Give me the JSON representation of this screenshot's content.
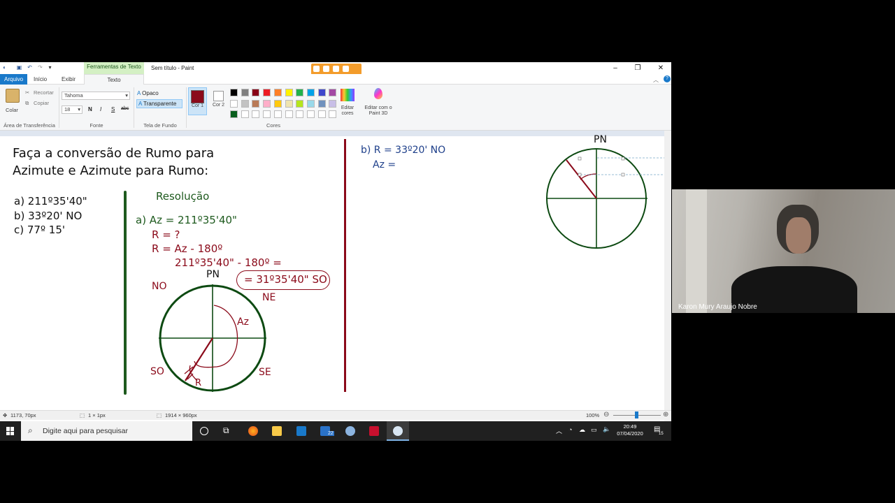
{
  "window": {
    "title": "Sem título - Paint",
    "context_tab": "Ferramentas de Texto"
  },
  "tabs": [
    "Arquivo",
    "Início",
    "Exibir",
    "Texto"
  ],
  "ribbon": {
    "clipboard": {
      "paste": "Colar",
      "cut": "Recortar",
      "copy": "Copiar",
      "group": "Área de Transferência"
    },
    "font": {
      "family": "Tahoma",
      "size": "18",
      "bold": "N",
      "italic": "I",
      "underline": "S",
      "strike": "abc",
      "group": "Fonte"
    },
    "background": {
      "opaque": "Opaco",
      "transparent": "Transparente",
      "group": "Tela de Fundo"
    },
    "colors": {
      "color1": "Cor 1",
      "color1_value": "#8b0a1a",
      "color2": "Cor 2",
      "color2_value": "#ffffff",
      "edit": "Editar cores",
      "paint3d": "Editar com o Paint 3D",
      "group": "Cores",
      "palette_row1": [
        "#000000",
        "#7f7f7f",
        "#880015",
        "#ed1c24",
        "#ff7f27",
        "#fff200",
        "#22b14c",
        "#00a2e8",
        "#3f48cc",
        "#a349a4"
      ],
      "palette_row2": [
        "#ffffff",
        "#c3c3c3",
        "#b97a57",
        "#ffaec9",
        "#ffc90e",
        "#efe4b0",
        "#b5e61d",
        "#99d9ea",
        "#7092be",
        "#c8bfe7"
      ],
      "palette_row3": [
        "#0a5f1e",
        "#ffffff",
        "#ffffff",
        "#ffffff",
        "#ffffff",
        "#ffffff",
        "#ffffff",
        "#ffffff",
        "#ffffff",
        "#ffffff"
      ]
    }
  },
  "canvas": {
    "heading_line1": "Faça a conversão de Rumo para",
    "heading_line2": "Azimute e Azimute para Rumo:",
    "items": [
      "a) 211º35'40\"",
      "b) 33º20' NO",
      "c) 77º 15'"
    ],
    "resolution_title": "Resolução",
    "a_line1": "a) Az = 211º35'40\"",
    "a_line2": "R = ?",
    "a_line3": "R = Az - 180º",
    "a_line4": "211º35'40\" - 180º =",
    "a_result": "= 31º35'40\" SO",
    "compass_labels": {
      "pn": "PN",
      "no": "NO",
      "ne": "NE",
      "so": "SO",
      "se": "SE",
      "az": "Az",
      "r": "R"
    },
    "b_line1": "b) R = 33º20' NO",
    "b_line2": "Az =",
    "compass2_pn": "PN"
  },
  "status": {
    "cursor": "1173, 70px",
    "selection": "1 × 1px",
    "size": "1914 × 960px",
    "zoom": "100%"
  },
  "taskbar": {
    "search_placeholder": "Digite aqui para pesquisar",
    "time": "20:49",
    "date": "07/04/2020",
    "mail_badge": "22",
    "notif_badge": "15"
  },
  "webcam": {
    "name": "Karon Mury Araujo Nobre"
  }
}
